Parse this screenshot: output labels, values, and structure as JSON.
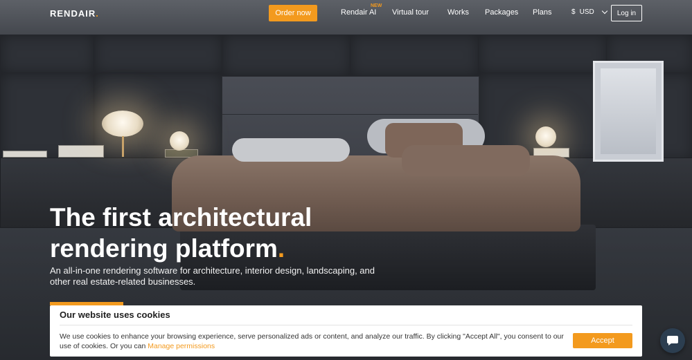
{
  "header": {
    "logo_text": "RENDAIR",
    "logo_dot": ".",
    "order_button": "Order now",
    "nav": [
      "Rendair AI",
      "Virtual tour",
      "Works",
      "Packages",
      "Plans"
    ],
    "new_badge": "NEW",
    "currency_symbol": "$",
    "currency_code": "USD",
    "login_button": "Log in"
  },
  "hero": {
    "headline_line1": "The first architectural",
    "headline_line2": "rendering platform",
    "headline_dot": ".",
    "subtext": "An all-in-one rendering software for architecture, interior design, landscaping, and other real estate-related businesses."
  },
  "cookie_banner": {
    "title": "Our website uses cookies",
    "text": "We use cookies to enhance your browsing experience, serve personalized ads or content, and analyze our traffic. By clicking \"Accept All\", you consent to our use of cookies. Or you can",
    "link": "Manage permissions",
    "accept_button": "Accept"
  },
  "chat": {
    "icon": "chat-bubble-icon"
  },
  "colors": {
    "accent": "#f39a1e",
    "text": "#ffffff",
    "banner_bg": "#ffffff"
  }
}
